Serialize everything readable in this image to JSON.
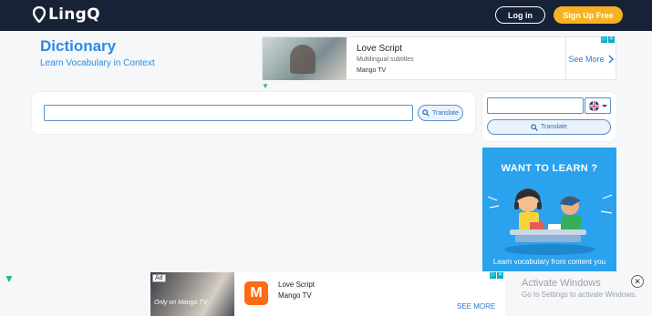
{
  "header": {
    "brand": "LingQ",
    "login_label": "Log in",
    "signup_label": "Sign Up Free"
  },
  "page": {
    "title": "Dictionary",
    "subtitle": "Learn Vocabulary in Context"
  },
  "ad_top": {
    "title": "Love Script",
    "line1": "Multilingual subtitles",
    "line2": "Mango TV",
    "cta": "See More"
  },
  "main_search": {
    "value": "",
    "translate_label": "Translate"
  },
  "side_search": {
    "value": "",
    "language_flag": "uk-flag",
    "translate_label": "Translate"
  },
  "ad_learn": {
    "headline": "WANT TO LEARN ?",
    "subline": "Learn vocabulary from content you"
  },
  "ad_bottom": {
    "badge": "Ad",
    "poster_text": "Only on Mango TV",
    "brand_letter": "M",
    "title": "Love Script",
    "subtitle": "Mango TV",
    "cta": "SEE MORE"
  },
  "watermark": {
    "line1": "Activate Windows",
    "line2": "Go to Settings to activate Windows."
  },
  "colors": {
    "nav_bg": "#172236",
    "accent_blue": "#2a8be8",
    "signup_orange": "#f6b221",
    "ad_blue": "#2aa2ee"
  }
}
